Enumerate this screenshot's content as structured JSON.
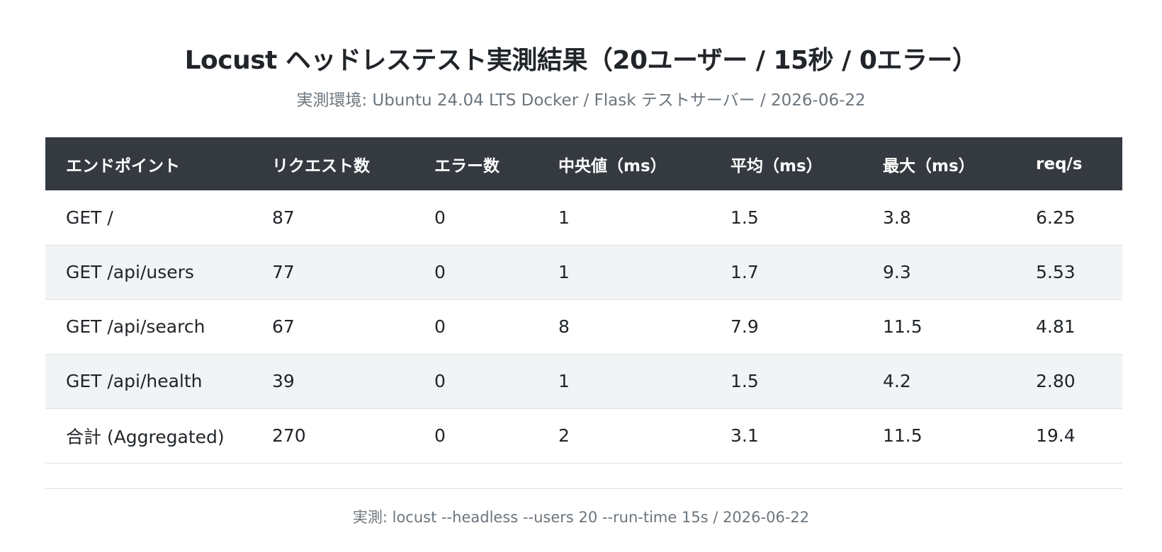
{
  "chart_data": {
    "type": "table",
    "title": "Locust ヘッドレステスト実測結果（20ユーザー / 15秒 / 0エラー）",
    "subtitle": "実測環境: Ubuntu 24.04 LTS Docker / Flask テストサーバー / 2026-06-22",
    "columns": [
      "エンドポイント",
      "リクエスト数",
      "エラー数",
      "中央値（ms）",
      "平均（ms）",
      "最大（ms）",
      "req/s"
    ],
    "rows": [
      [
        "GET /",
        "87",
        "0",
        "1",
        "1.5",
        "3.8",
        "6.25"
      ],
      [
        "GET /api/users",
        "77",
        "0",
        "1",
        "1.7",
        "9.3",
        "5.53"
      ],
      [
        "GET /api/search",
        "67",
        "0",
        "8",
        "7.9",
        "11.5",
        "4.81"
      ],
      [
        "GET /api/health",
        "39",
        "0",
        "1",
        "1.5",
        "4.2",
        "2.80"
      ],
      [
        "合計 (Aggregated)",
        "270",
        "0",
        "2",
        "3.1",
        "11.5",
        "19.4"
      ]
    ],
    "footer": "実測: locust --headless --users 20 --run-time 15s / 2026-06-22"
  },
  "colors": {
    "header_bg": "#343a40",
    "header_text": "#ffffff",
    "stripe_bg": "#f1f3f5",
    "muted_text": "#6c757d",
    "border": "#dee2e6"
  }
}
